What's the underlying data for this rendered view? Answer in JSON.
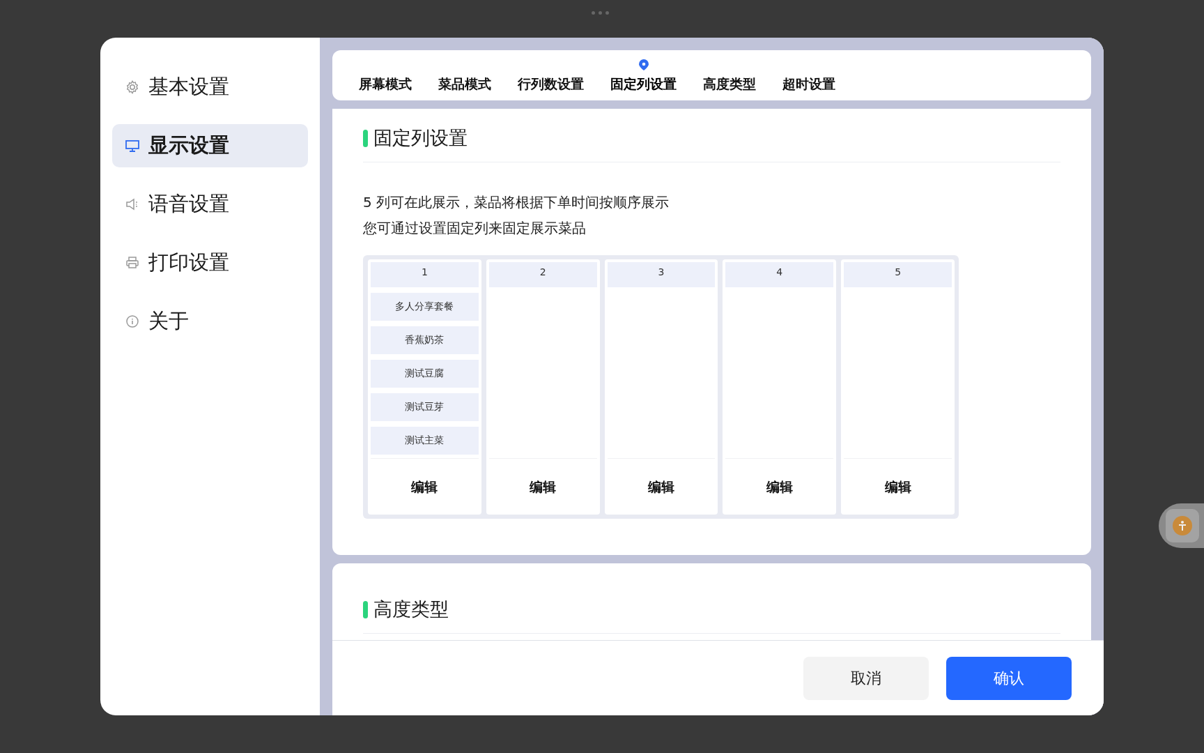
{
  "sidebar": {
    "items": [
      {
        "label": "基本设置",
        "selected": false
      },
      {
        "label": "显示设置",
        "selected": true
      },
      {
        "label": "语音设置",
        "selected": false
      },
      {
        "label": "打印设置",
        "selected": false
      },
      {
        "label": "关于",
        "selected": false
      }
    ]
  },
  "tabs": [
    {
      "label": "屏幕模式",
      "selected": false
    },
    {
      "label": "菜品模式",
      "selected": false
    },
    {
      "label": "行列数设置",
      "selected": false
    },
    {
      "label": "固定列设置",
      "selected": true
    },
    {
      "label": "高度类型",
      "selected": false
    },
    {
      "label": "超时设置",
      "selected": false
    }
  ],
  "fixed_columns_section": {
    "title": "固定列设置",
    "description": [
      "5 列可在此展示，菜品将根据下单时间按顺序展示",
      "您可通过设置固定列来固定展示菜品"
    ],
    "columns": [
      {
        "header": "1",
        "dishes": [
          "多人分享套餐",
          "香蕉奶茶",
          "测试豆腐",
          "测试豆芽",
          "测试主菜"
        ],
        "edit_label": "编辑"
      },
      {
        "header": "2",
        "edit_label": "编辑"
      },
      {
        "header": "3",
        "edit_label": "编辑"
      },
      {
        "header": "4",
        "edit_label": "编辑"
      },
      {
        "header": "5",
        "edit_label": "编辑"
      }
    ]
  },
  "height_type_section": {
    "title": "高度类型"
  },
  "footer": {
    "cancel": "取消",
    "confirm": "确认"
  }
}
